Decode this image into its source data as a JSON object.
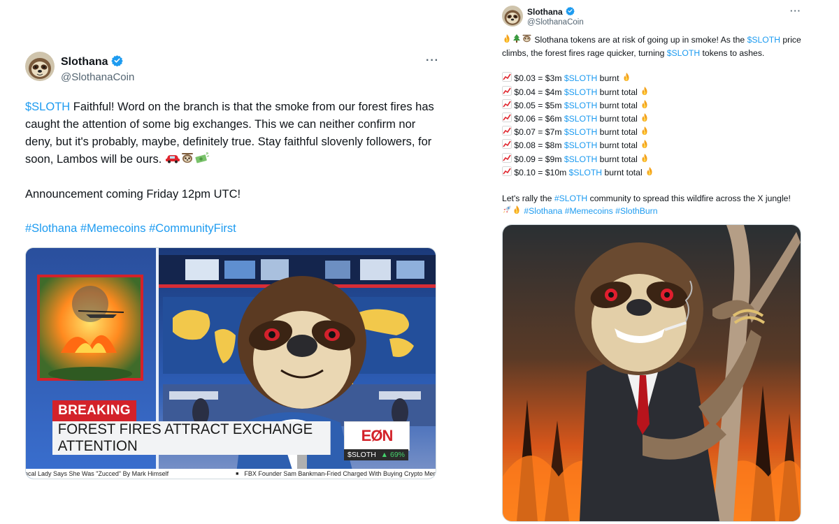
{
  "left_tweet": {
    "display_name": "Slothana",
    "handle": "@SlothanaCoin",
    "more_label": "···",
    "line1": {
      "cashtag": "$SLOTH",
      "text": " Faithful! Word on the branch is that the smoke from our forest fires has caught the attention of some big exchanges. This we can neither confirm nor deny, but it's probably, maybe, definitely true. Stay faithful slovenly followers, for soon, Lambos will be ours. "
    },
    "emojis": [
      "car",
      "sloth",
      "money"
    ],
    "announcement": "Announcement coming Friday 12pm UTC!",
    "hashtags": [
      "#Slothana",
      "#Memecoins",
      "#CommunityFirst"
    ],
    "media": {
      "breaking": "BREAKING",
      "headline": "FOREST FIRES ATTRACT EXCHANGE ATTENTION",
      "network_logo": "EØN",
      "ticker_symbol": "$SLOTH",
      "ticker_change": "▲ 69%",
      "crawl_1": "ncal Lady Says She Was \"Zucced\" By Mark Himself",
      "crawl_2": "FBX Founder Sam Bankman-Fried Charged With Buying Crypto Meme"
    }
  },
  "right_tweet": {
    "display_name": "Slothana",
    "handle": "@SlothanaCoin",
    "more_label": "···",
    "intro": {
      "prefix": " Slothana tokens are at risk of going up in smoke! As the ",
      "cashtag1": "$SLOTH",
      "middle": " price climbs, the forest fires rage quicker, turning ",
      "cashtag2": "$SLOTH",
      "suffix": " tokens to ashes."
    },
    "burn_rows": [
      {
        "price": " $0.03 = $3m ",
        "cashtag": "$SLOTH",
        "tail": " burnt "
      },
      {
        "price": " $0.04 = $4m ",
        "cashtag": "$SLOTH",
        "tail": " burnt total "
      },
      {
        "price": " $0.05 = $5m ",
        "cashtag": "$SLOTH",
        "tail": " burnt total "
      },
      {
        "price": " $0.06 = $6m ",
        "cashtag": "$SLOTH",
        "tail": " burnt total "
      },
      {
        "price": " $0.07 = $7m ",
        "cashtag": "$SLOTH",
        "tail": " burnt total "
      },
      {
        "price": " $0.08 = $8m ",
        "cashtag": "$SLOTH",
        "tail": " burnt total "
      },
      {
        "price": " $0.09 = $9m ",
        "cashtag": "$SLOTH",
        "tail": " burnt total "
      },
      {
        "price": " $0.10 = $10m ",
        "cashtag": "$SLOTH",
        "tail": " burnt total "
      }
    ],
    "rally": {
      "prefix": "Let's rally the ",
      "hashtag": "#SLOTH",
      "suffix": " community to spread this wildfire across the X jungle! "
    },
    "hashtags": [
      "#Slothana",
      "#Memecoins",
      "#SlothBurn"
    ]
  },
  "colors": {
    "link": "#1d9bf0",
    "verified": "#1d9bf0",
    "text": "#0f1419",
    "muted": "#536471",
    "breaking_red": "#d3222a"
  },
  "icons": [
    "verified-badge-icon",
    "more-icon",
    "fire-icon",
    "tree-icon",
    "sloth-icon",
    "chart-up-icon",
    "car-icon",
    "money-icon",
    "rocket-icon"
  ]
}
